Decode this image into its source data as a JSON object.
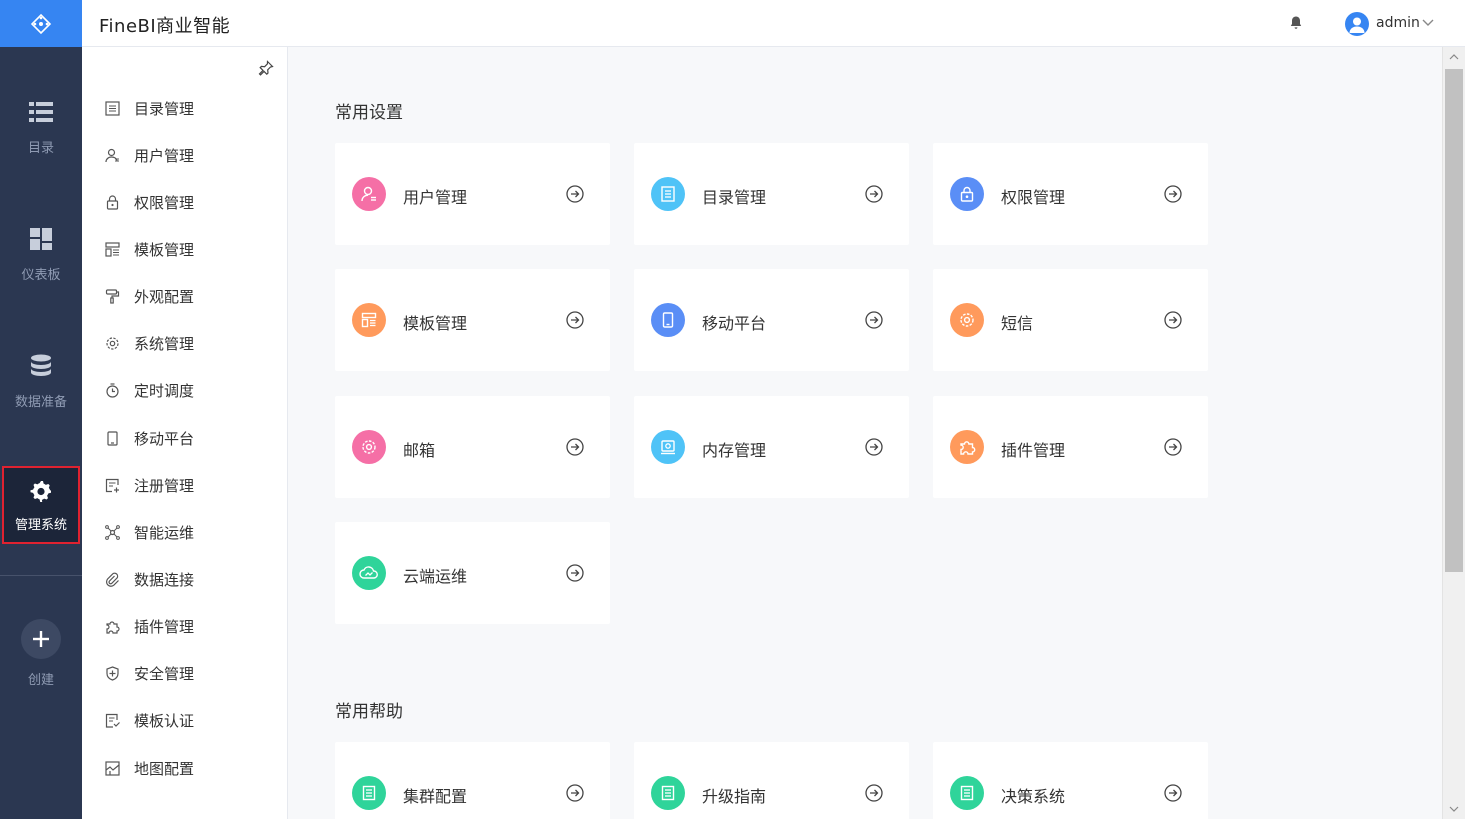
{
  "app": {
    "title": "FineBI商业智能"
  },
  "header": {
    "username": "admin"
  },
  "rail": {
    "items": [
      {
        "label": "目录",
        "icon": "list-icon"
      },
      {
        "label": "仪表板",
        "icon": "dashboard-icon"
      },
      {
        "label": "数据准备",
        "icon": "database-icon"
      },
      {
        "label": "管理系统",
        "icon": "gear-icon",
        "active": true
      }
    ],
    "create_label": "创建",
    "active_border_color": "#e02230"
  },
  "menu": {
    "items": [
      {
        "label": "目录管理",
        "icon": "catalog-icon"
      },
      {
        "label": "用户管理",
        "icon": "user-icon"
      },
      {
        "label": "权限管理",
        "icon": "lock-icon"
      },
      {
        "label": "模板管理",
        "icon": "template-icon"
      },
      {
        "label": "外观配置",
        "icon": "paint-roller-icon"
      },
      {
        "label": "系统管理",
        "icon": "settings-icon"
      },
      {
        "label": "定时调度",
        "icon": "timer-icon"
      },
      {
        "label": "移动平台",
        "icon": "mobile-icon"
      },
      {
        "label": "注册管理",
        "icon": "register-icon"
      },
      {
        "label": "智能运维",
        "icon": "network-icon"
      },
      {
        "label": "数据连接",
        "icon": "link-icon"
      },
      {
        "label": "插件管理",
        "icon": "puzzle-icon"
      },
      {
        "label": "安全管理",
        "icon": "shield-icon"
      },
      {
        "label": "模板认证",
        "icon": "certify-icon"
      },
      {
        "label": "地图配置",
        "icon": "map-icon"
      }
    ]
  },
  "content": {
    "common_settings_title": "常用设置",
    "common_help_title": "常用帮助",
    "settings_cards": [
      {
        "label": "用户管理",
        "icon": "user-icon",
        "color": "#f56fa6"
      },
      {
        "label": "目录管理",
        "icon": "catalog-icon",
        "color": "#4fc3f7"
      },
      {
        "label": "权限管理",
        "icon": "lock-icon",
        "color": "#5a8ef6"
      },
      {
        "label": "模板管理",
        "icon": "template-icon",
        "color": "#ff9a5c"
      },
      {
        "label": "移动平台",
        "icon": "mobile-icon",
        "color": "#5a8ef6"
      },
      {
        "label": "短信",
        "icon": "sms-gear-icon",
        "color": "#ff9a5c"
      },
      {
        "label": "邮箱",
        "icon": "mail-gear-icon",
        "color": "#f56fa6"
      },
      {
        "label": "内存管理",
        "icon": "memory-icon",
        "color": "#4fc3f7"
      },
      {
        "label": "插件管理",
        "icon": "puzzle-icon",
        "color": "#ff9a5c"
      },
      {
        "label": "云端运维",
        "icon": "cloud-icon",
        "color": "#2fd49a"
      }
    ],
    "help_cards": [
      {
        "label": "集群配置",
        "icon": "doc-icon",
        "color": "#2fd49a"
      },
      {
        "label": "升级指南",
        "icon": "doc-icon",
        "color": "#2fd49a"
      },
      {
        "label": "决策系统",
        "icon": "doc-icon",
        "color": "#2fd49a"
      }
    ]
  },
  "colors": {
    "brand": "#3685f2",
    "rail_bg": "#2b3751"
  }
}
